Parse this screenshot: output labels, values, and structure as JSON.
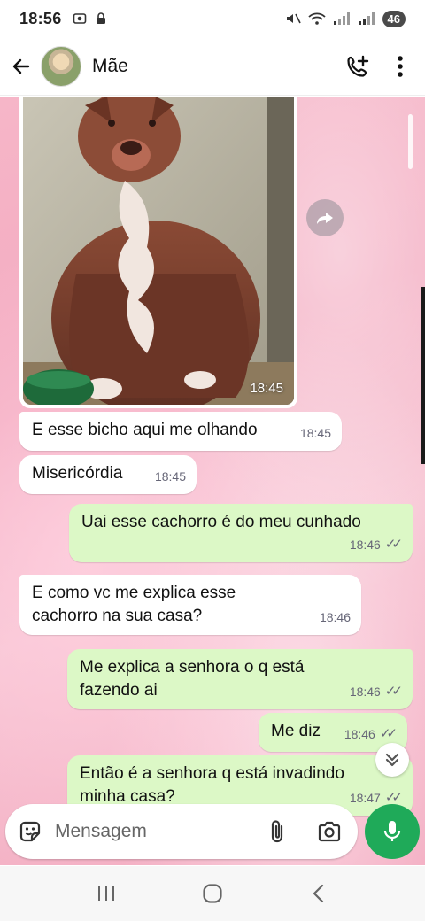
{
  "status_bar": {
    "time": "18:56",
    "battery": "46"
  },
  "header": {
    "contact_name": "Mãe",
    "icons": [
      "back-arrow-icon",
      "avatar",
      "add-call-icon",
      "more-vert-icon"
    ]
  },
  "messages": [
    {
      "direction": "in",
      "type": "image",
      "time": "18:45",
      "image_description_icon": "dog-photo"
    },
    {
      "direction": "in",
      "text": "E esse bicho aqui me olhando",
      "time": "18:45"
    },
    {
      "direction": "in",
      "text": "Misericórdia",
      "time": "18:45"
    },
    {
      "direction": "out",
      "text": "Uai esse cachorro é do meu cunhado",
      "time": "18:46",
      "status": "read"
    },
    {
      "direction": "in",
      "text": "E como vc me explica esse cachorro na sua casa?",
      "time": "18:46"
    },
    {
      "direction": "out",
      "text": "Me explica a senhora o q está fazendo ai",
      "time": "18:46",
      "status": "read"
    },
    {
      "direction": "out",
      "text": "Me diz",
      "time": "18:46",
      "status": "read"
    },
    {
      "direction": "out",
      "text": "Então é a senhora q está invadindo minha casa?",
      "time": "18:47",
      "status": "read"
    }
  ],
  "composer": {
    "placeholder": "Mensagem"
  },
  "colors": {
    "incoming": "#ffffff",
    "outgoing": "#dcf8c6",
    "mic": "#1faa59",
    "wallpaper": "#f3a9bf"
  }
}
